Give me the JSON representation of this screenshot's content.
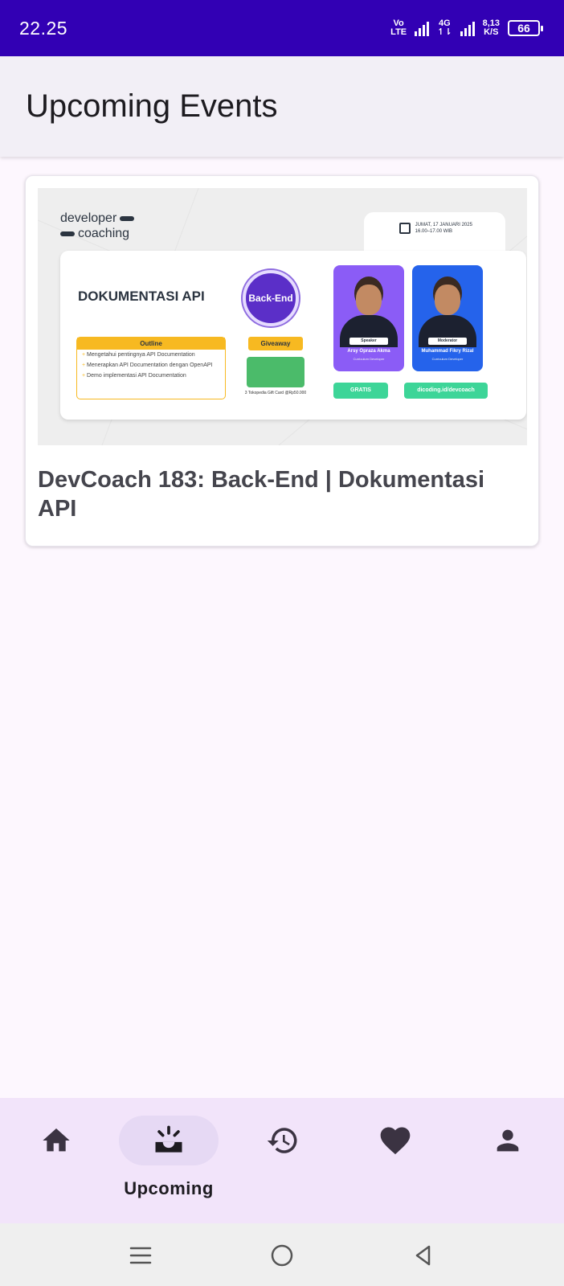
{
  "status_bar": {
    "time": "22.25",
    "volte_top": "Vo",
    "volte_bottom": "LTE",
    "network": "4G",
    "speed_value": "8,13",
    "speed_unit": "K/S",
    "battery": "66"
  },
  "app_bar": {
    "title": "Upcoming Events"
  },
  "events": [
    {
      "title": "DevCoach 183: Back-End | Dokumentasi API",
      "banner": {
        "logo_line1": "developer",
        "logo_line2": "coaching",
        "date_line1": "JUMAT, 17 JANUARI 2025",
        "date_line2": "16.00–17.00 WIB",
        "heading": "DOKUMENTASI API",
        "badge": "Back-End",
        "outline_title": "Outline",
        "outline_items": [
          "Mengetahui pentingnya API Documentation",
          "Menerapkan API Documentation dengan OpenAPI",
          "Demo implementasi API Documentation"
        ],
        "giveaway_title": "Giveaway",
        "giveaway_text": "3 Tokopedia Gift Card @Rp50.000",
        "speaker_role": "Speaker",
        "speaker_name": "Arsy Opraza Akma",
        "speaker_job": "Curriculum Developer",
        "moderator_role": "Moderator",
        "moderator_name": "Muhammad Fikry Rizal",
        "moderator_job": "Curriculum Developer",
        "button_free": "GRATIS",
        "button_link": "dicoding.id/devcoach"
      }
    }
  ],
  "bottom_nav": {
    "items": [
      {
        "icon": "home-icon",
        "label": ""
      },
      {
        "icon": "upcoming-icon",
        "label": "Upcoming",
        "active": true
      },
      {
        "icon": "history-icon",
        "label": ""
      },
      {
        "icon": "heart-icon",
        "label": ""
      },
      {
        "icon": "person-icon",
        "label": ""
      }
    ]
  },
  "colors": {
    "status_bar": "#3200b4",
    "app_bar": "#f2eff6",
    "background": "#fdf7fe",
    "bottom_nav": "#f2e4fa",
    "nav_indicator": "#e6d9f4",
    "title_text": "#45454d"
  }
}
